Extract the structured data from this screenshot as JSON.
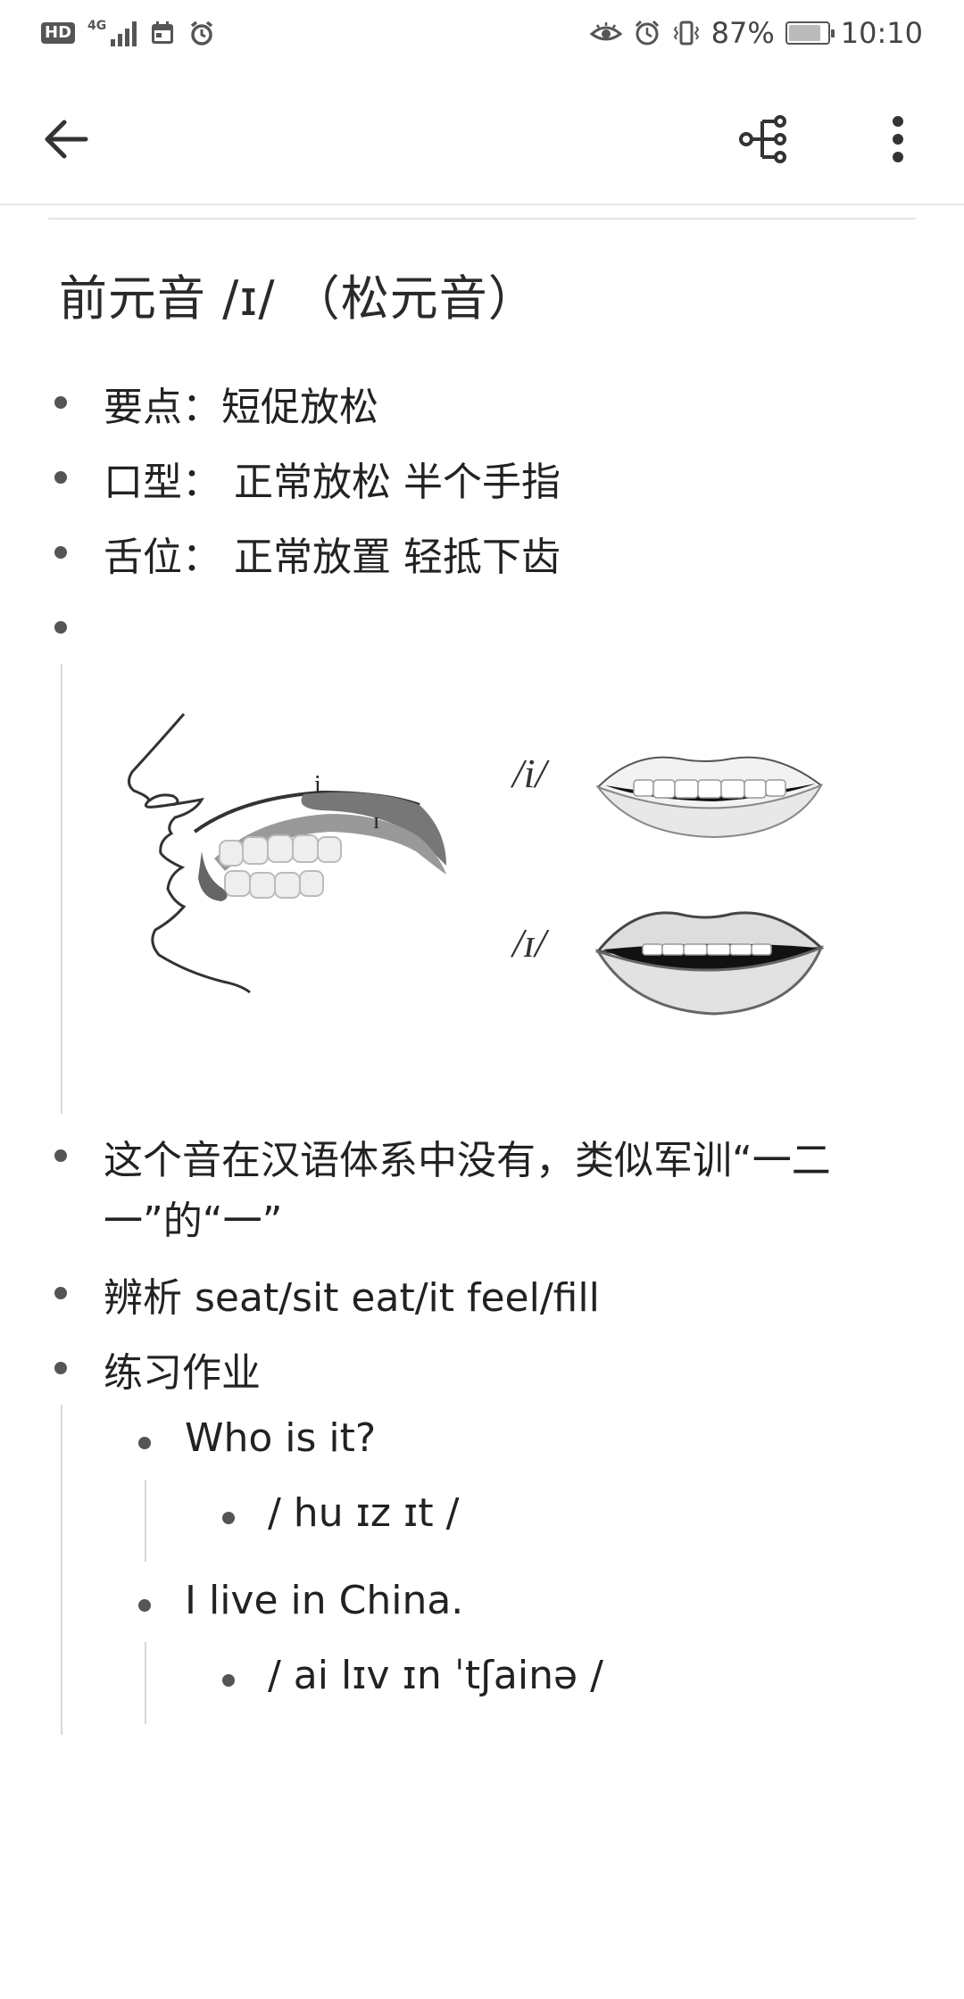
{
  "status_bar": {
    "left_icons": [
      "hd-icon",
      "signal-icon",
      "calendar-icon",
      "alarm-icon"
    ],
    "network_label": "4G",
    "hd_label": "HD",
    "battery": "87%",
    "battery_level": 0.87,
    "time": "10:10",
    "right_icons": [
      "eye-icon",
      "alarm-icon",
      "vibrate-icon",
      "battery-icon"
    ]
  },
  "app_bar": {
    "icons": [
      "back-arrow-icon",
      "mind-map-icon",
      "more-vertical-icon"
    ]
  },
  "note": {
    "title": "前元音  /ɪ/  （松元音）",
    "bullets": [
      "要点：短促放松",
      "口型：  正常放松 半个手指",
      "舌位：  正常放置 轻抵下齿",
      ""
    ],
    "diagram_labels": {
      "long_i": "/i/",
      "short_i": "/ɪ/",
      "tongue_long": "i",
      "tongue_short": "ɪ"
    },
    "description_line1": "这个音在汉语体系中没有，类似军训“一二",
    "description_line2": "一”的“一”",
    "compare": "辨析 seat/sit eat/it feel/fill",
    "homework_label": "练习作业",
    "exercises": [
      {
        "sentence": "Who is it?",
        "phonetic": "/ hu ɪz ɪt /"
      },
      {
        "sentence": "I live in China.",
        "phonetic": "/ ai lɪv ɪn ˈtʃainə /"
      }
    ]
  },
  "colors": {
    "text": "#222222",
    "bullet": "#555555",
    "divider": "#e4e4e4",
    "background": "#ffffff"
  }
}
